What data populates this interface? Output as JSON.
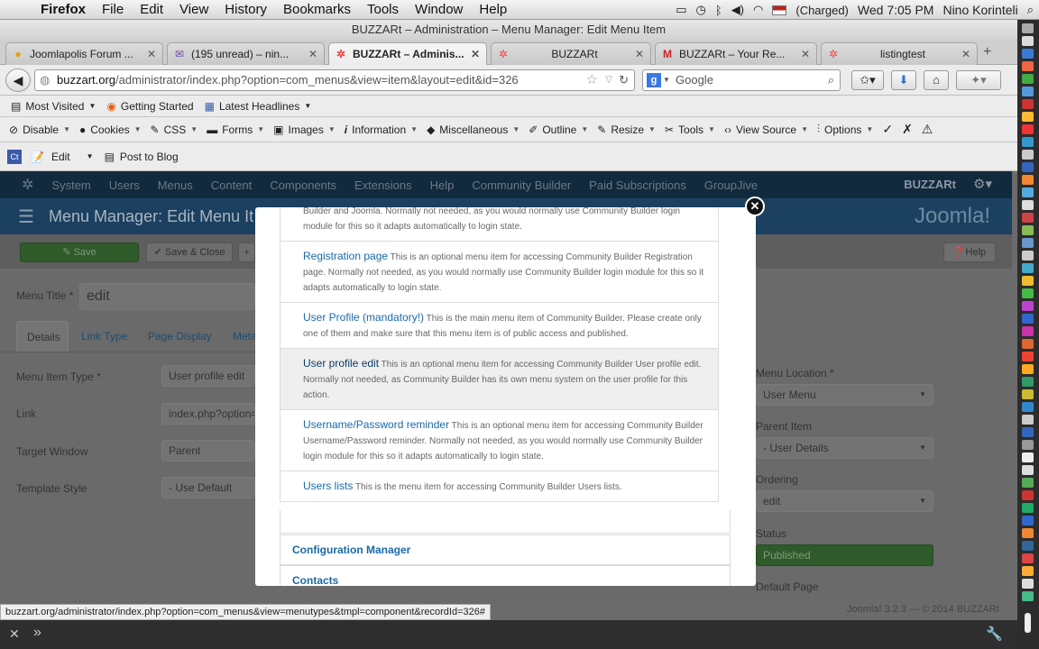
{
  "mac_menu": {
    "app": "Firefox",
    "items": [
      "File",
      "Edit",
      "View",
      "History",
      "Bookmarks",
      "Tools",
      "Window",
      "Help"
    ],
    "battery": "(Charged)",
    "clock": "Wed 7:05 PM",
    "user": "Nino Korinteli"
  },
  "window_title": "BUZZARt – Administration – Menu Manager: Edit Menu Item",
  "tabs": [
    {
      "label": "Joomlapolis Forum ...",
      "icon": "joomlapolis-icon"
    },
    {
      "label": "(195 unread) – nin...",
      "icon": "mail-icon"
    },
    {
      "label": "BUZZARt – Adminis...",
      "icon": "joomla-icon"
    },
    {
      "label": "BUZZARt",
      "icon": "joomla-icon"
    },
    {
      "label": "BUZZARt – Your Re...",
      "icon": "gmail-icon"
    },
    {
      "label": "listingtest",
      "icon": "joomla-icon"
    }
  ],
  "url": {
    "domain": "buzzart.org",
    "path": "/administrator/index.php?option=com_menus&view=item&layout=edit&id=326"
  },
  "search_placeholder": "Google",
  "bookmarks": [
    "Most Visited",
    "Getting Started",
    "Latest Headlines"
  ],
  "dev_toolbar": [
    "Disable",
    "Cookies",
    "CSS",
    "Forms",
    "Images",
    "Information",
    "Miscellaneous",
    "Outline",
    "Resize",
    "Tools",
    "View Source",
    "Options"
  ],
  "extra_toolbar": {
    "edit": "Edit",
    "post": "Post to Blog"
  },
  "joomla": {
    "nav": [
      "System",
      "Users",
      "Menus",
      "Content",
      "Components",
      "Extensions",
      "Help",
      "Community Builder",
      "Paid Subscriptions",
      "GroupJive"
    ],
    "site_name": "BUZZARt",
    "page_title": "Menu Manager: Edit Menu It",
    "logo_text": "Joomla!",
    "buttons": {
      "save": "Save",
      "save_close": "Save & Close",
      "help": "Help"
    },
    "menu_title_label": "Menu Title *",
    "menu_title_value": "edit",
    "tabs": [
      "Details",
      "Link Type",
      "Page Display",
      "Meta"
    ],
    "fields": [
      {
        "label": "Menu Item Type *",
        "value": "User profile edit"
      },
      {
        "label": "Link",
        "value": "index.php?option="
      },
      {
        "label": "Target Window",
        "value": "Parent"
      },
      {
        "label": "Template Style",
        "value": "- Use Default"
      }
    ],
    "right_fields": [
      {
        "label": "Menu Location *",
        "value": "User Menu"
      },
      {
        "label": "Parent Item",
        "value": "- User Details"
      },
      {
        "label": "Ordering",
        "value": "edit"
      },
      {
        "label": "Status",
        "value": "Published"
      },
      {
        "label": "Default Page",
        "value": ""
      }
    ],
    "footer": "Joomla! 3.2.3 — © 2014 BUZZARt"
  },
  "modal": {
    "items": [
      {
        "title": "",
        "desc": "Builder and Joomla. Normally not needed, as you would normally use Community Builder login module for this so it adapts automatically to login state."
      },
      {
        "title": "Registration page",
        "desc": "This is an optional menu item for accessing Community Builder Registration page. Normally not needed, as you would normally use Community Builder login module for this so it adapts automatically to login state."
      },
      {
        "title": "User Profile (mandatory!)",
        "desc": "This is the main menu item of Community Builder. Please create only one of them and make sure that this menu item is of public access and published."
      },
      {
        "title": "User profile edit",
        "desc": "This is an optional menu item for accessing Community Builder User profile edit. Normally not needed, as Community Builder has its own menu system on the user profile for this action."
      },
      {
        "title": "Username/Password reminder",
        "desc": "This is an optional menu item for accessing Community Builder Username/Password reminder. Normally not needed, as you would normally use Community Builder login module for this so it adapts automatically to login state."
      },
      {
        "title": "Users lists",
        "desc": "This is the menu item for accessing Community Builder Users lists."
      }
    ],
    "sections": [
      "Configuration Manager",
      "Contacts"
    ]
  },
  "status_url": "buzzart.org/administrator/index.php?option=com_menus&view=menutypes&tmpl=component&recordId=326#"
}
